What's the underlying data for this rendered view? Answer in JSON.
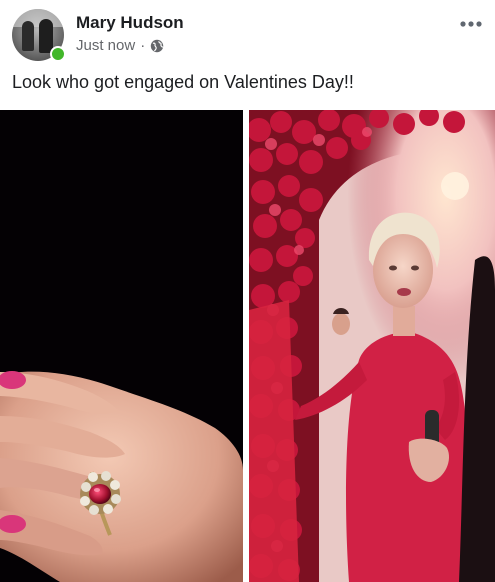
{
  "post": {
    "author": "Mary Hudson",
    "timestamp": "Just now",
    "separator": "·",
    "privacy_icon": "globe-icon",
    "more_icon": "more-horizontal-icon",
    "caption": "Look who got engaged on Valentines Day!!",
    "online_status_color": "#42b72a"
  },
  "photos": [
    {
      "subject": "hand with ring"
    },
    {
      "subject": "woman in red dress"
    }
  ],
  "colors": {
    "name_text": "#1c1e21",
    "meta_text": "#65676b",
    "background": "#ffffff"
  }
}
